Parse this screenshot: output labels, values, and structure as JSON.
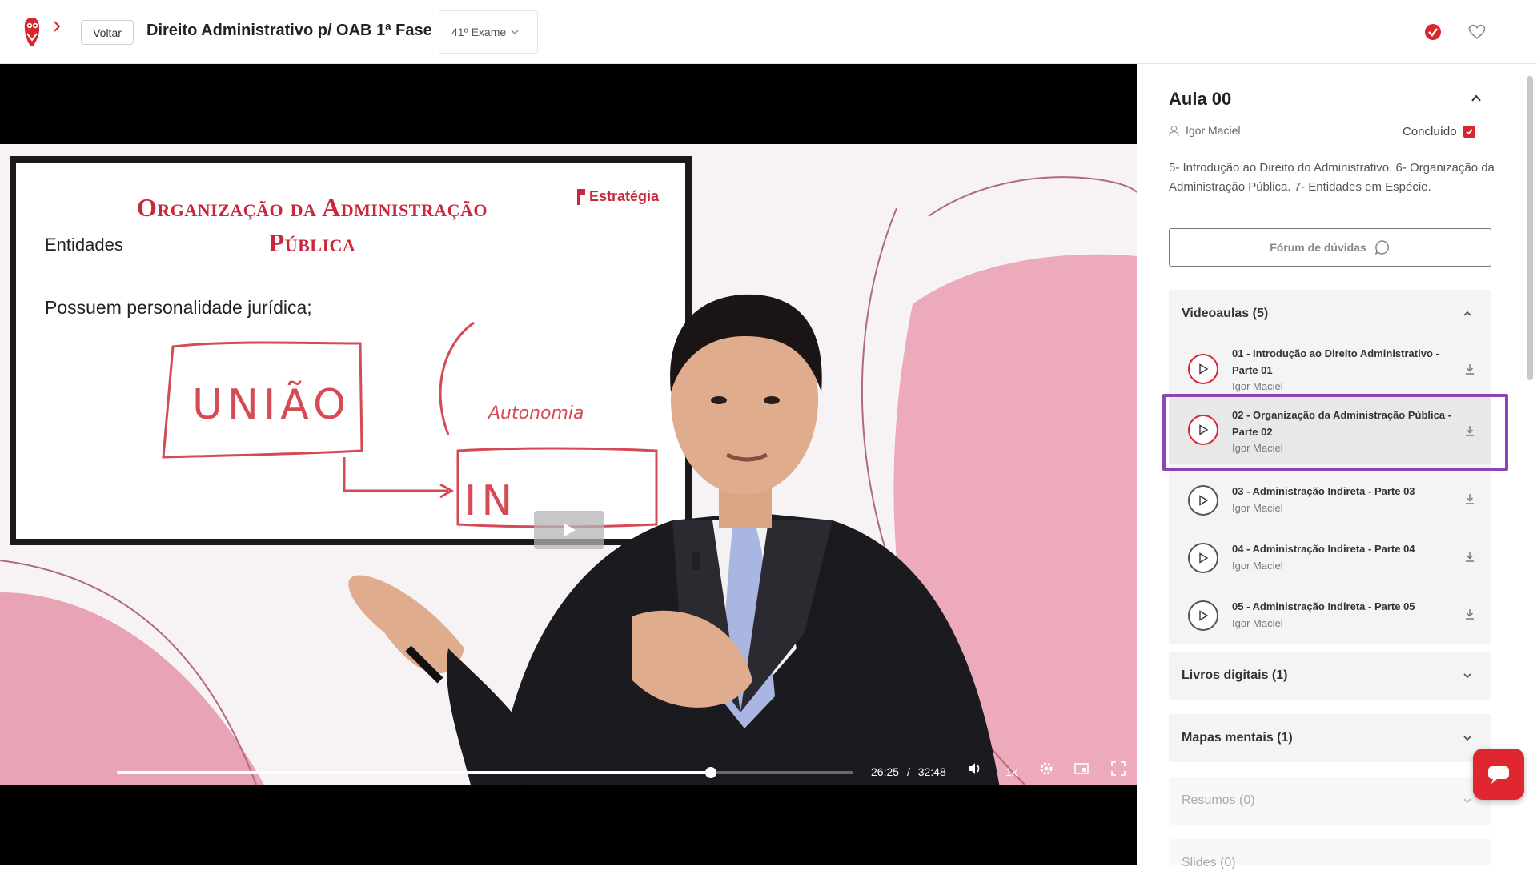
{
  "header": {
    "back_label": "Voltar",
    "course_title": "Direito Administrativo p/ OAB 1ª Fase",
    "exam_selected": "41º Exame"
  },
  "slide": {
    "title_line1": "Organização da Administração",
    "title_line2": "Pública",
    "subtitle": "Entidades",
    "text": "Possuem personalidade jurídica;",
    "brand": "Estratégia",
    "handwriting_box": "UNIÃO",
    "handwriting_arrow": "Autonomia",
    "handwriting_partial": "IN"
  },
  "player": {
    "current_time": "26:25",
    "separator": "/",
    "duration": "32:48",
    "speed": "1x",
    "progress_fraction": 0.806
  },
  "panel": {
    "aula_title": "Aula 00",
    "author": "Igor Maciel",
    "concluido_label": "Concluído",
    "description": "5- Introdução ao Direito do Administrativo. 6- Organização da Administração Pública. 7- Entidades em Espécie.",
    "forum_label": "Fórum de dúvidas",
    "videoaulas_label": "Videoaulas (5)",
    "videos": [
      {
        "title": "01 - Introdução ao Direito Administrativo - Parte 01",
        "author": "Igor Maciel"
      },
      {
        "title": "02 - Organização da Administração Pública - Parte 02",
        "author": "Igor Maciel"
      },
      {
        "title": "03 - Administração Indireta - Parte 03",
        "author": "Igor Maciel"
      },
      {
        "title": "04 - Administração Indireta - Parte 04",
        "author": "Igor Maciel"
      },
      {
        "title": "05 - Administração Indireta - Parte 05",
        "author": "Igor Maciel"
      }
    ],
    "livros_label": "Livros digitais (1)",
    "mapas_label": "Mapas mentais (1)",
    "resumos_label": "Resumos (0)",
    "slides_label": "Slides (0)"
  },
  "icons": {
    "logo": "owl-logo-icon",
    "breadcrumb": "chevron-right-icon",
    "completed": "check-circle-icon",
    "favorite": "heart-icon",
    "forum": "chat-bubble-icon",
    "download": "download-icon",
    "chat": "chat-icon"
  },
  "colors": {
    "brand_red": "#d7262e",
    "highlight_purple": "#8b45b5",
    "slide_red": "#c8283a"
  }
}
